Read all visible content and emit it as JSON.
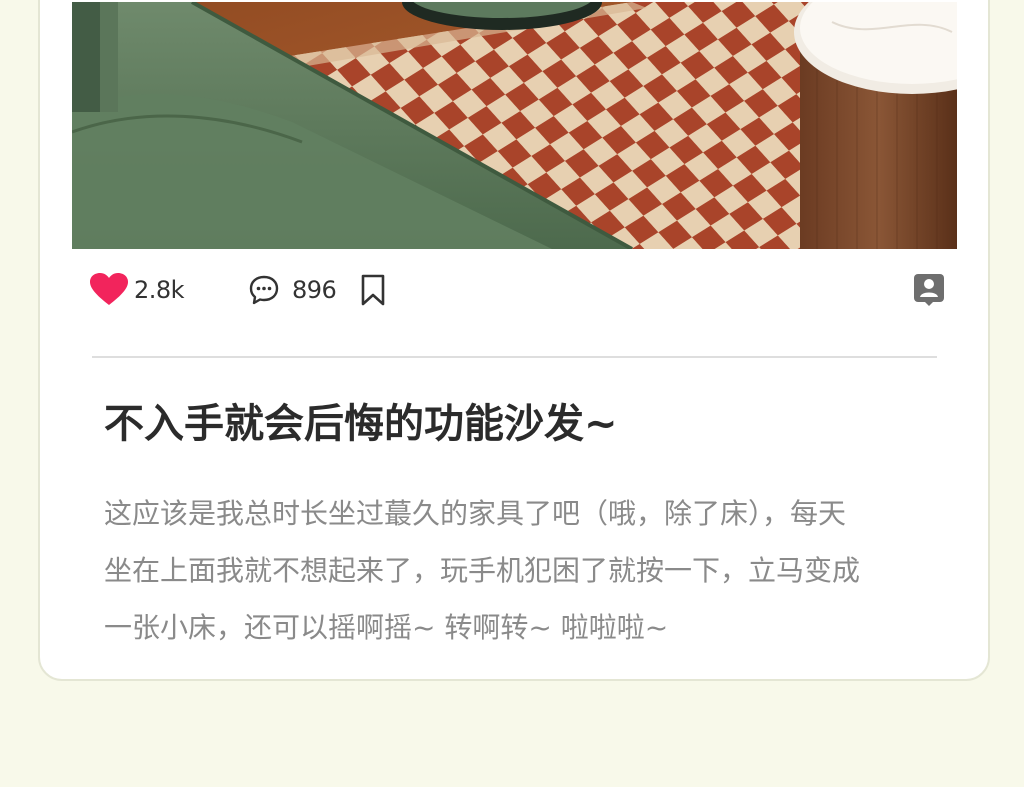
{
  "post": {
    "likes": "2.8k",
    "comments": "896",
    "title": "不入手就会后悔的功能沙发~",
    "body_lines": [
      "这应该是我总时长坐过蕞久的家具了吧（哦，除了床），每天",
      "坐在上面我就不想起来了，玩手机犯困了就按一下，立马变成",
      "一张小床，还可以摇啊摇~ 转啊转~ 啦啦啦~"
    ]
  },
  "icons": {
    "like": "heart-icon",
    "comment": "comment-bubble-icon",
    "save": "bookmark-icon",
    "profile": "contact-card-icon"
  },
  "colors": {
    "page_background": "#f8f9ea",
    "like_heart": "#f2245c",
    "title_text": "#2b2b2b",
    "body_text": "#8a8a8a"
  }
}
